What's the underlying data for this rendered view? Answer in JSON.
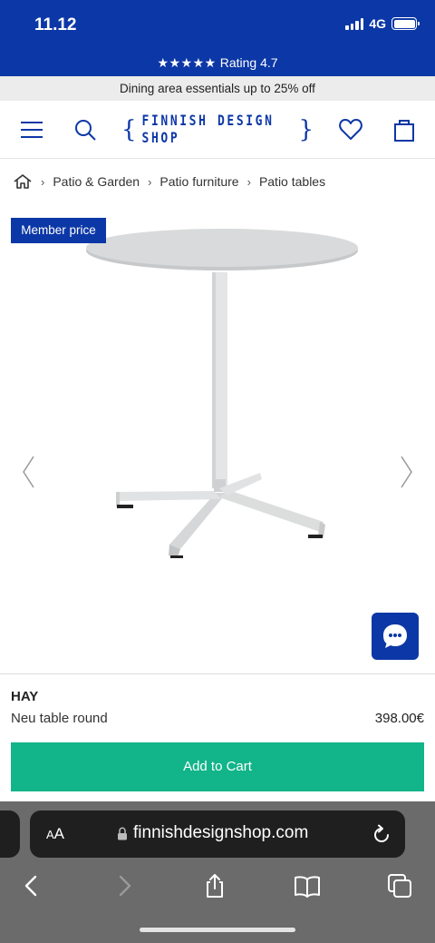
{
  "status_bar": {
    "time": "11.12",
    "network": "4G"
  },
  "site_rating": {
    "stars": "★★★★★",
    "label": "Rating 4.7"
  },
  "promo_banner": {
    "text": "Dining area essentials up to 25% off"
  },
  "header": {
    "logo_text": "FINNISH DESIGN SHOP",
    "logo_brace_left": "{",
    "logo_brace_right": "}"
  },
  "breadcrumb": {
    "separator": "›",
    "items": [
      "Patio & Garden",
      "Patio furniture",
      "Patio tables"
    ]
  },
  "product": {
    "badge": "Member price",
    "brand": "HAY",
    "name": "Neu table round",
    "price": "398.00€",
    "add_to_cart": "Add to Cart"
  },
  "browser": {
    "aa_label_small": "A",
    "aa_label_large": "A",
    "url": "finnishdesignshop.com"
  },
  "colors": {
    "brand_blue": "#0c37a6",
    "cart_green": "#12b489",
    "promo_bg": "#ececec"
  },
  "icons": [
    "signal-icon",
    "battery-icon",
    "menu-icon",
    "search-icon",
    "heart-icon",
    "bag-icon",
    "home-icon",
    "chevron-left-icon",
    "chevron-right-icon",
    "chat-icon",
    "lock-icon",
    "reload-icon",
    "back-icon",
    "forward-icon",
    "share-icon",
    "bookmarks-icon",
    "tabs-icon"
  ]
}
